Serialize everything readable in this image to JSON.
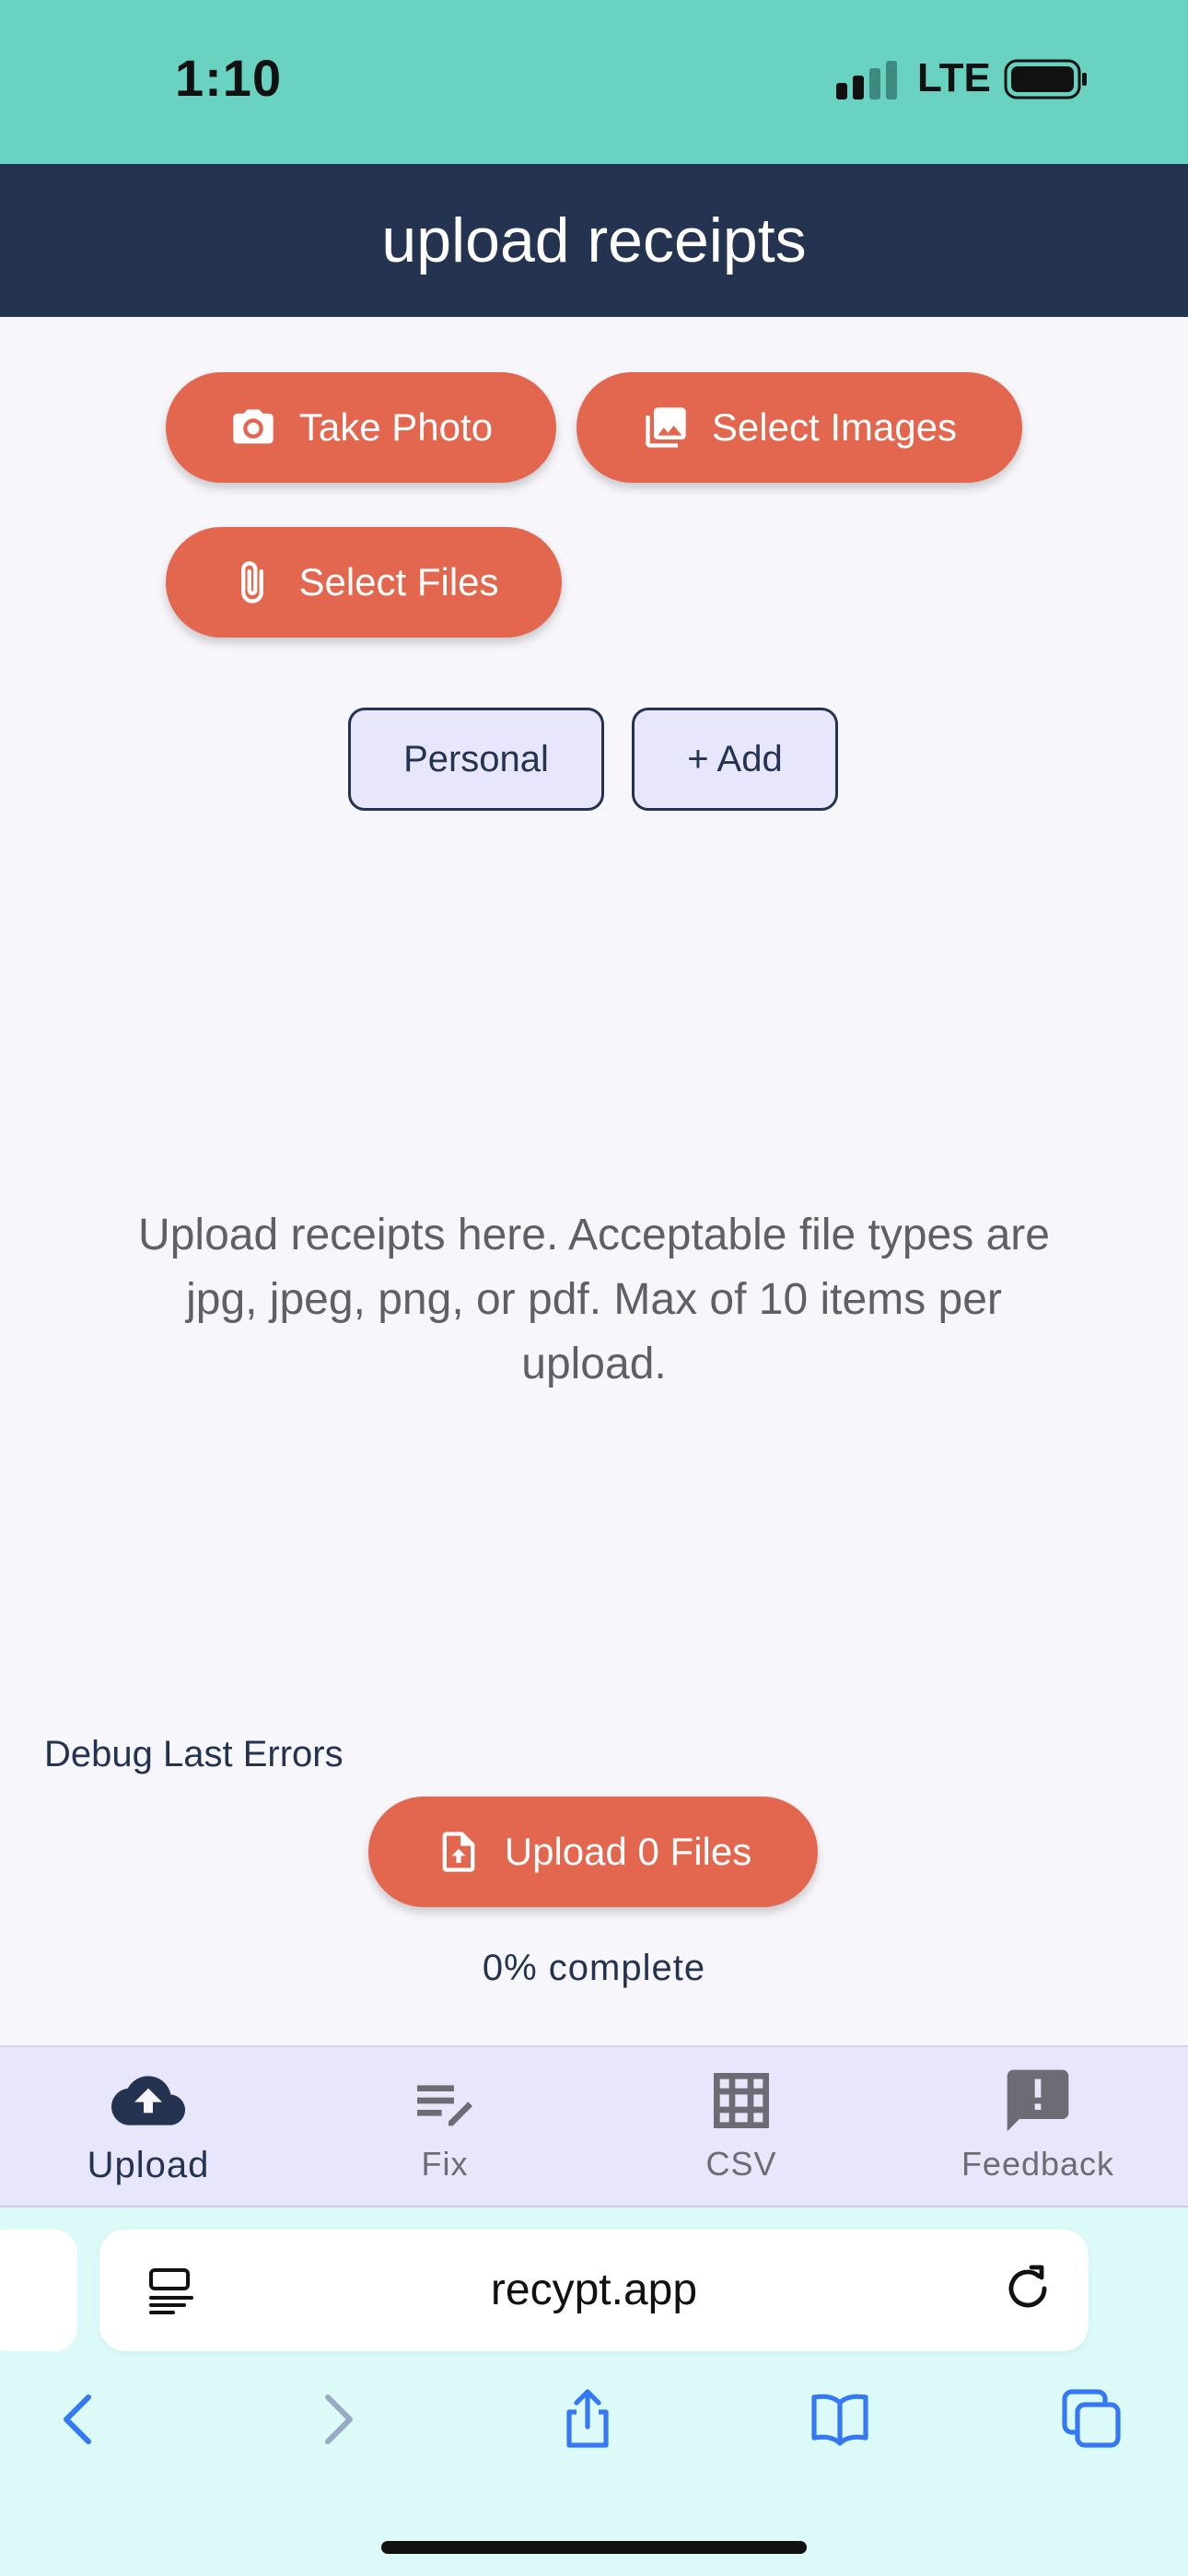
{
  "status_bar": {
    "time": "1:10",
    "network": "LTE"
  },
  "header": {
    "title": "upload receipts"
  },
  "actions": {
    "take_photo": "Take Photo",
    "select_images": "Select Images",
    "select_files": "Select Files"
  },
  "tags": {
    "personal": "Personal",
    "add": "+ Add"
  },
  "info_text": "Upload receipts here. Acceptable file types are jpg, jpeg, png, or pdf. Max of 10 items per upload.",
  "debug": {
    "label": "Debug Last Errors"
  },
  "upload": {
    "button_label": "Upload 0 Files",
    "progress_text": "0% complete"
  },
  "bottom_nav": {
    "items": [
      {
        "label": "Upload",
        "icon": "cloud-upload-icon",
        "active": true
      },
      {
        "label": "Fix",
        "icon": "edit-list-icon",
        "active": false
      },
      {
        "label": "CSV",
        "icon": "grid-icon",
        "active": false
      },
      {
        "label": "Feedback",
        "icon": "feedback-icon",
        "active": false
      }
    ]
  },
  "browser": {
    "url": "recypt.app"
  },
  "colors": {
    "status_bar_bg": "#69d2c1",
    "header_bg": "#233350",
    "accent": "#e3674f",
    "tag_bg": "#e8e6fb",
    "page_bg": "#f6f6fb",
    "safari_bg": "#dcfbf8",
    "safari_blue": "#3478f6"
  }
}
